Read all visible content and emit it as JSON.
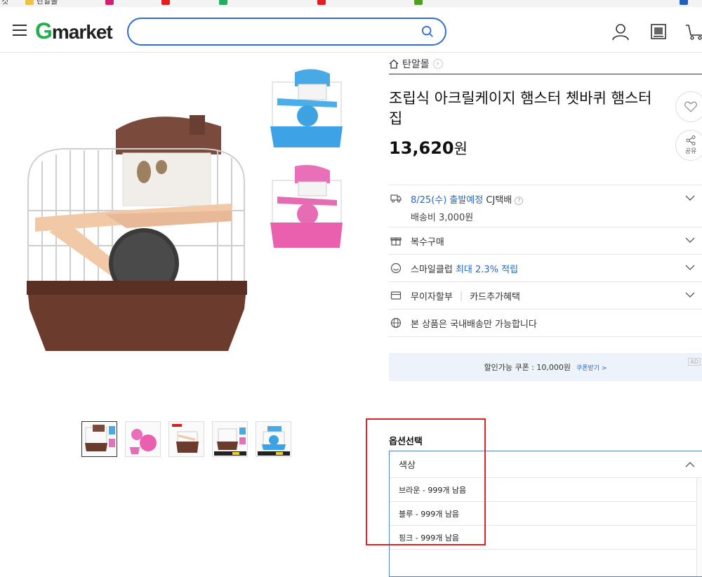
{
  "bookmarks": [
    {
      "label": "것",
      "color": "#f0c040"
    },
    {
      "label": "탄알몰",
      "color": "#f0c040"
    },
    {
      "label": "",
      "color": "#d02070"
    },
    {
      "label": "",
      "color": "#e02020"
    },
    {
      "label": "",
      "color": "#20b060"
    },
    {
      "label": "",
      "color": "#e02020"
    },
    {
      "label": "",
      "color": "#50a020"
    },
    {
      "label": "",
      "color": "#2060c0"
    }
  ],
  "header": {
    "logo_g": "G",
    "logo_rest": "market",
    "search_placeholder": "",
    "brand_color": "#22b14c",
    "accent_color": "#2f6bdc"
  },
  "product": {
    "shop_name": "탄알몰",
    "title": "조립식 아크릴케이지 햄스터 쳇바퀴 햄스터집",
    "price": "13,620",
    "price_unit": "원",
    "share_label": "공유"
  },
  "delivery": {
    "date_text": "8/25(수) 출발예정",
    "carrier": "CJ택배",
    "fee": "배송비 3,000원"
  },
  "rows": {
    "multi_buy": "복수구매",
    "smile_prefix": "스마일클럽",
    "smile_highlight": "최대 2.3% 적립",
    "installment": "무이자할부",
    "card_benefit": "카드추가혜택",
    "domestic_only": "본 상품은 국내배송만 가능합니다"
  },
  "coupon": {
    "text": "할인가능 쿠폰 : 10,000원",
    "get_label": "쿠폰받기 >",
    "ad_label": "AD"
  },
  "options": {
    "section_title": "옵션선택",
    "dropdown_label": "색상",
    "items": [
      "브라운 - 999개 남음",
      "블루 - 999개 남음",
      "핑크 - 999개 남음"
    ]
  },
  "colors": {
    "highlight_box": "#d9242a",
    "link_blue": "#2b64c8"
  }
}
